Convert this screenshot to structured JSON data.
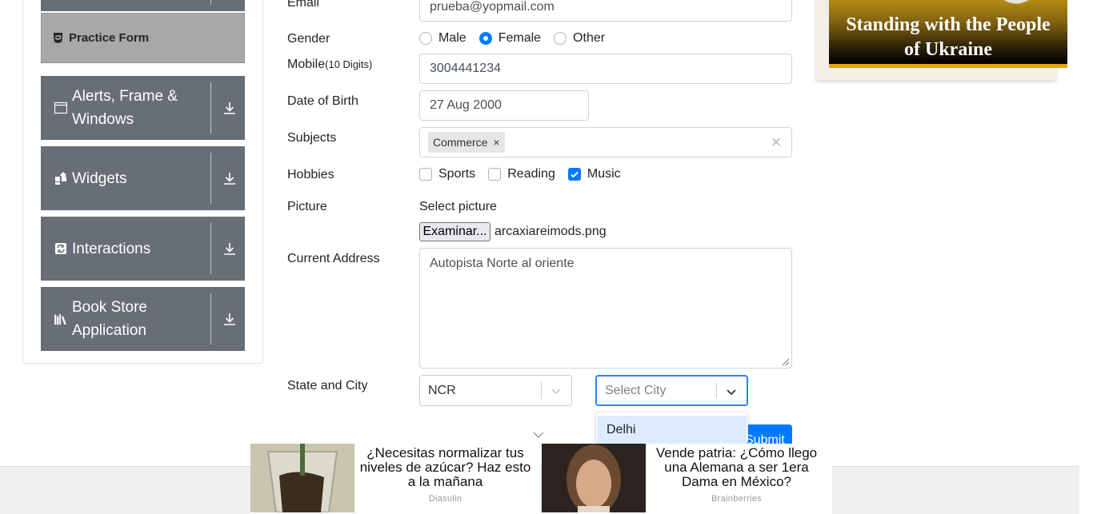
{
  "sidebar": {
    "practice_form_label": "Practice Form",
    "groups": [
      {
        "label_line1": "Alerts, Frame &",
        "label_line2": "Windows",
        "icon": "window-icon"
      },
      {
        "label_line1": "Widgets",
        "label_line2": "",
        "icon": "widgets-icon"
      },
      {
        "label_line1": "Interactions",
        "label_line2": "",
        "icon": "interactions-icon"
      },
      {
        "label_line1": "Book Store",
        "label_line2": "Application",
        "icon": "books-icon"
      }
    ]
  },
  "form": {
    "email_label": "Email",
    "email_value": "prueba@yopmail.com",
    "gender_label": "Gender",
    "gender_options": [
      "Male",
      "Female",
      "Other"
    ],
    "gender_selected": "Female",
    "mobile_label": "Mobile",
    "mobile_hint": "(10 Digits)",
    "mobile_value": "3004441234",
    "dob_label": "Date of Birth",
    "dob_value": "27 Aug 2000",
    "subjects_label": "Subjects",
    "subjects_chips": [
      "Commerce"
    ],
    "hobbies_label": "Hobbies",
    "hobbies_options": [
      "Sports",
      "Reading",
      "Music"
    ],
    "hobbies_checked": [
      "Music"
    ],
    "picture_label": "Picture",
    "picture_select_text": "Select picture",
    "file_button_label": "Examinar...",
    "file_name": "arcaxiareimods.png",
    "address_label": "Current Address",
    "address_value": "Autopista Norte al oriente",
    "state_city_label": "State and City",
    "state_value": "NCR",
    "city_placeholder": "Select City",
    "city_dropdown_options": [
      "Delhi"
    ],
    "submit_label": "Submit"
  },
  "banner": {
    "line1": "Standing with the People",
    "line2": "of Ukraine"
  },
  "ads": [
    {
      "title": "¿Necesitas normalizar tus niveles de azúcar? Haz esto a la mañana",
      "source": "Diasulin"
    },
    {
      "title": "Vende patria: ¿Cómo llego una Alemana a ser 1era Dama en México?",
      "source": "Brainberries"
    }
  ],
  "colors": {
    "sidebar_group_bg": "#686e77",
    "practice_item_bg": "#a8a8a8",
    "accent_blue": "#007bff",
    "focus_blue": "#2684ff",
    "banner_gold": "#e2a414"
  }
}
